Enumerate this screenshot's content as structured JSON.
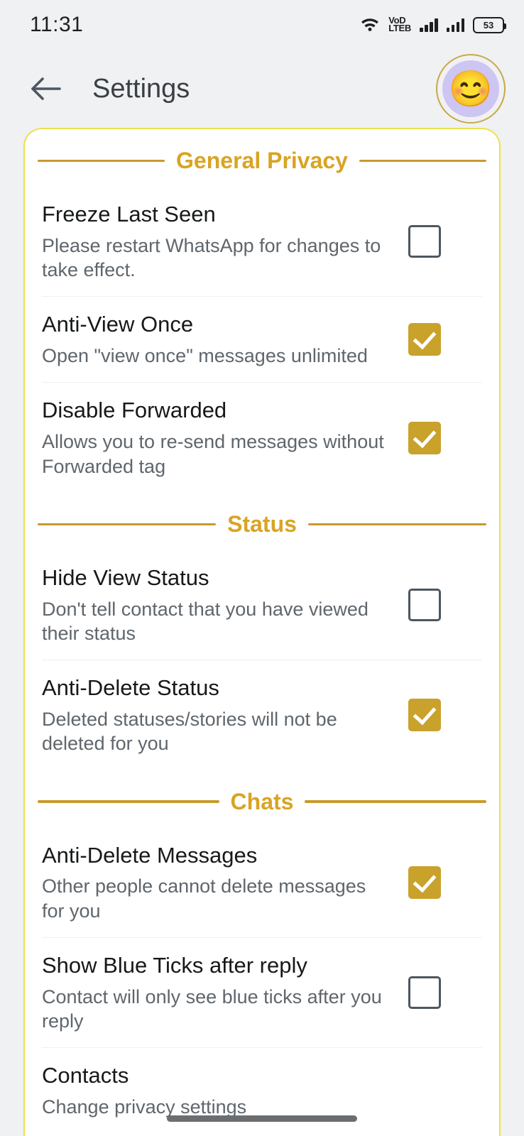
{
  "statusbar": {
    "time": "11:31",
    "wifi_icon": "wifi-icon",
    "volte_top": "VoD",
    "volte_bottom": "LTEB",
    "signal1_icon": "signal-bars-icon",
    "signal2_icon": "signal-bars-icon",
    "battery_level": "53"
  },
  "appbar": {
    "back_icon": "back-arrow-icon",
    "title": "Settings",
    "avatar_icon": "smiling-face-emoji",
    "avatar_glyph": "😊"
  },
  "colors": {
    "accent_gold": "#d9a424",
    "rule_gold": "#c8992e",
    "card_border": "#ece14f",
    "checkbox_on": "#c9a22c",
    "checkbox_off_border": "#4d5761",
    "background": "#f0f1f2",
    "title_text": "#16181a",
    "sub_text": "#5f666c"
  },
  "sections": [
    {
      "title": "General Privacy",
      "rows": [
        {
          "title": "Freeze Last Seen",
          "subtitle": "Please restart WhatsApp for changes to take effect.",
          "checked": false
        },
        {
          "title": "Anti-View Once",
          "subtitle": "Open \"view once\" messages unlimited",
          "checked": true
        },
        {
          "title": "Disable Forwarded",
          "subtitle": "Allows you to re-send messages without Forwarded tag",
          "checked": true
        }
      ]
    },
    {
      "title": "Status",
      "rows": [
        {
          "title": "Hide View Status",
          "subtitle": "Don't tell contact that you have viewed their status",
          "checked": false
        },
        {
          "title": "Anti-Delete Status",
          "subtitle": "Deleted statuses/stories will not be deleted for you",
          "checked": true
        }
      ]
    },
    {
      "title": "Chats",
      "rows": [
        {
          "title": "Anti-Delete Messages",
          "subtitle": "Other people cannot delete messages for you",
          "checked": true
        },
        {
          "title": "Show Blue Ticks after reply",
          "subtitle": "Contact will only see blue ticks after you reply",
          "checked": false
        },
        {
          "title": "Contacts",
          "subtitle": "Change privacy settings",
          "checked": null
        }
      ]
    }
  ]
}
